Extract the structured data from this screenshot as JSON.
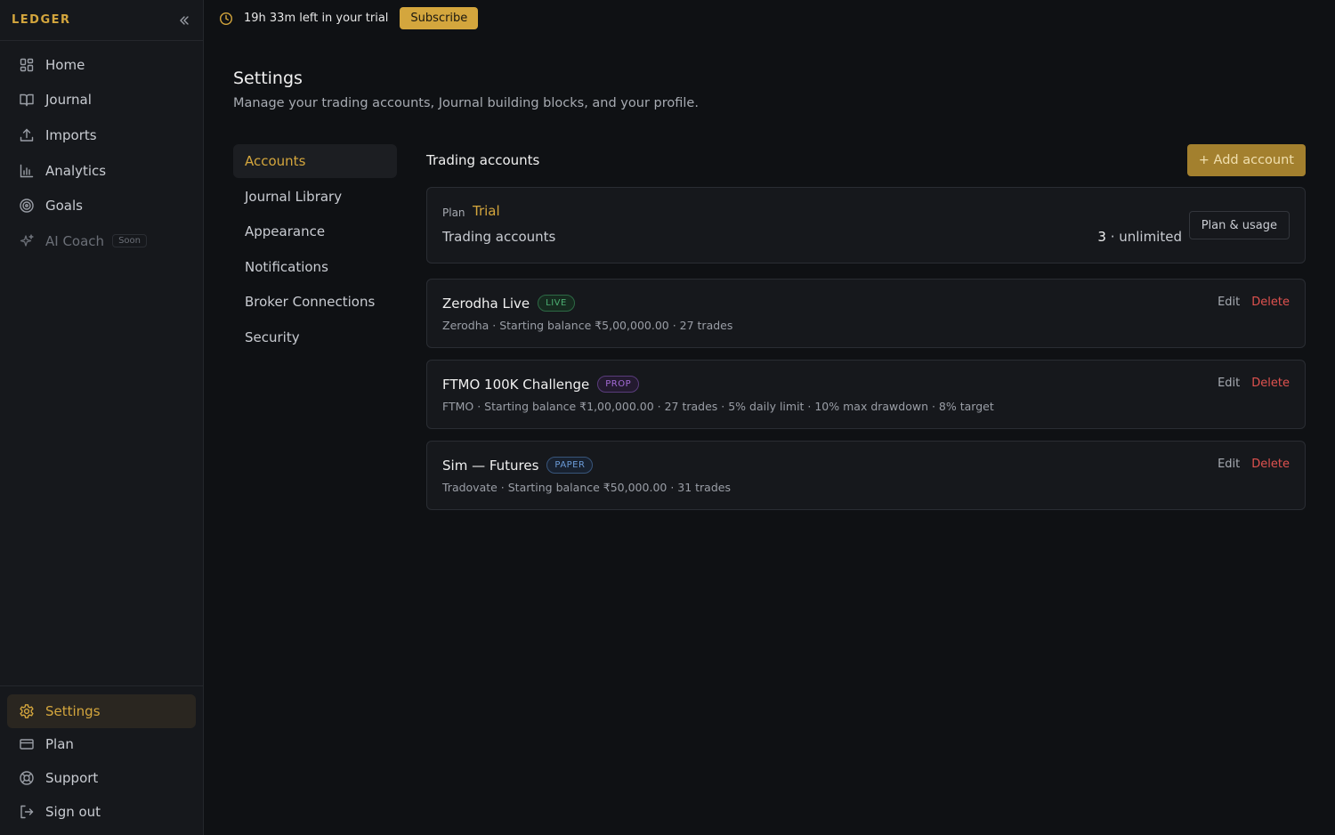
{
  "brand": "LEDGER",
  "sidebar": {
    "items": [
      {
        "label": "Home",
        "icon": "grid-icon"
      },
      {
        "label": "Journal",
        "icon": "book-icon"
      },
      {
        "label": "Imports",
        "icon": "upload-icon"
      },
      {
        "label": "Analytics",
        "icon": "bar-chart-icon"
      },
      {
        "label": "Goals",
        "icon": "target-icon"
      },
      {
        "label": "AI Coach",
        "icon": "sparkle-icon",
        "badge": "Soon"
      }
    ],
    "bottom_items": [
      {
        "label": "Settings",
        "icon": "gear-icon",
        "active": true
      },
      {
        "label": "Plan",
        "icon": "card-icon"
      },
      {
        "label": "Support",
        "icon": "lifebuoy-icon"
      },
      {
        "label": "Sign out",
        "icon": "logout-icon"
      }
    ]
  },
  "trial": {
    "text": "19h 33m left in your trial",
    "subscribe_label": "Subscribe"
  },
  "page": {
    "title": "Settings",
    "subtitle": "Manage your trading accounts, Journal building blocks, and your profile."
  },
  "settings_nav": [
    "Accounts",
    "Journal Library",
    "Appearance",
    "Notifications",
    "Broker Connections",
    "Security"
  ],
  "accounts_section": {
    "title": "Trading accounts",
    "add_label": "+ Add account"
  },
  "plan": {
    "label": "Plan",
    "value": "Trial",
    "accounts_label": "Trading accounts",
    "accounts_count": "3",
    "accounts_limit": " · unlimited",
    "usage_label": "Plan & usage"
  },
  "accounts": [
    {
      "name": "Zerodha Live",
      "badge": "LIVE",
      "meta": "Zerodha · Starting balance ₹5,00,000.00 · 27 trades",
      "edit": "Edit",
      "delete": "Delete"
    },
    {
      "name": "FTMO 100K Challenge",
      "badge": "PROP",
      "meta": "FTMO · Starting balance ₹1,00,000.00 · 27 trades · 5% daily limit · 10% max drawdown · 8% target",
      "edit": "Edit",
      "delete": "Delete"
    },
    {
      "name": "Sim — Futures",
      "badge": "PAPER",
      "meta": "Tradovate · Starting balance ₹50,000.00 · 31 trades",
      "edit": "Edit",
      "delete": "Delete"
    }
  ],
  "colors": {
    "accent": "#d4a63d",
    "background": "#0f1114",
    "sidebar": "#16181c",
    "danger": "#e0524f",
    "live": "#4cae72",
    "prop": "#a46bd6",
    "paper": "#6b9bd8"
  }
}
